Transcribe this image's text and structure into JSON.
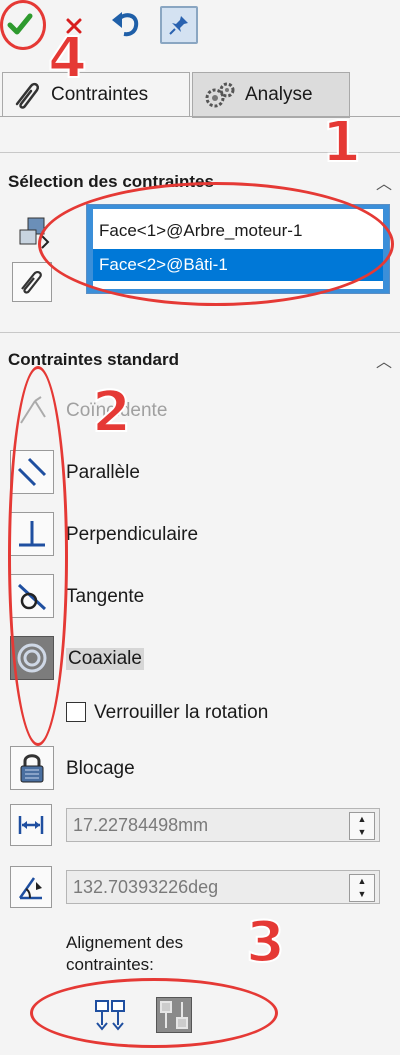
{
  "toolbar": {
    "ok": "check-icon",
    "cancel": "close-icon",
    "undo": "undo-icon",
    "pin": "pin-icon"
  },
  "tabs": [
    {
      "label": "Contraintes",
      "icon": "paperclip-icon",
      "active": true
    },
    {
      "label": "Analyse",
      "icon": "gears-icon",
      "active": false
    }
  ],
  "selection": {
    "title": "Sélection des contraintes",
    "items": [
      "Face<1>@Arbre_moteur-1",
      "Face<2>@Bâti-1"
    ]
  },
  "standard": {
    "title": "Contraintes standard",
    "items": [
      {
        "label": "Coïncidente",
        "icon": "coincident-icon",
        "dim": true
      },
      {
        "label": "Parallèle",
        "icon": "parallel-icon"
      },
      {
        "label": "Perpendiculaire",
        "icon": "perpendicular-icon"
      },
      {
        "label": "Tangente",
        "icon": "tangent-icon"
      },
      {
        "label": "Coaxiale",
        "icon": "coaxial-icon",
        "active": true
      }
    ],
    "lock_rotation": "Verrouiller la rotation",
    "lock_rotation_checked": false,
    "lock": "Blocage",
    "distance": "17.22784498mm",
    "angle": "132.70393226deg"
  },
  "alignment": {
    "title_line1": "Alignement des",
    "title_line2": "contraintes:"
  },
  "annotations": [
    "1",
    "2",
    "3",
    "4"
  ],
  "colors": {
    "annotation": "#e53935",
    "selection": "#0078d7"
  }
}
